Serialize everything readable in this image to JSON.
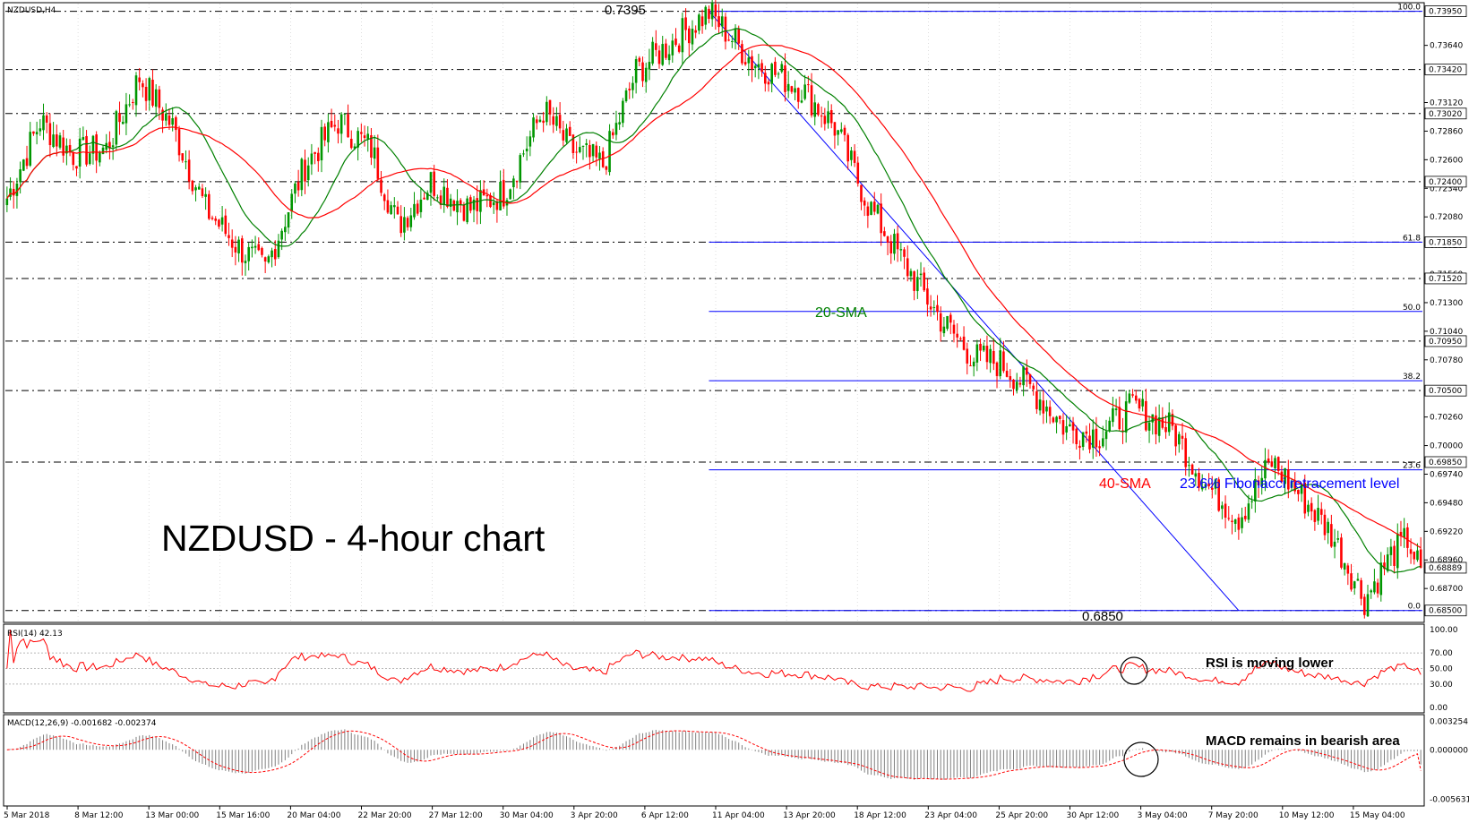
{
  "chart_data": {
    "type": "candlestick",
    "symbol_label": "NZDUSD,H4",
    "title": "NZDUSD - 4-hour chart",
    "colors": {
      "up": "#009600",
      "down": "#ff0000",
      "sma20": "#008000",
      "sma40": "#ff0000",
      "fib": "#0000ff",
      "trend": "#0000ff",
      "grid": "#000000",
      "rsi": "#ff0000",
      "macd_hist": "#808080",
      "macd_signal": "#ff0000"
    },
    "price_axis": {
      "ylim": [
        0.684,
        0.7402
      ],
      "ticks": [
        "0.73640",
        "0.73120",
        "0.72860",
        "0.72600",
        "0.72340",
        "0.72080",
        "0.71820",
        "0.71560",
        "0.71300",
        "0.71040",
        "0.70780",
        "0.70260",
        "0.70000",
        "0.69740",
        "0.69480",
        "0.69220",
        "0.68960",
        "0.68700"
      ],
      "boxed_levels": [
        "0.73950",
        "0.73420",
        "0.73020",
        "0.72400",
        "0.71850",
        "0.71520",
        "0.70950",
        "0.70500",
        "0.69850",
        "0.68889",
        "0.68500"
      ]
    },
    "x_tick_labels": [
      "5 Mar 2018",
      "8 Mar 12:00",
      "13 Mar 00:00",
      "15 Mar 16:00",
      "20 Mar 04:00",
      "22 Mar 20:00",
      "27 Mar 12:00",
      "30 Mar 04:00",
      "3 Apr 20:00",
      "6 Apr 12:00",
      "11 Apr 04:00",
      "13 Apr 20:00",
      "18 Apr 12:00",
      "23 Apr 04:00",
      "25 Apr 20:00",
      "30 Apr 12:00",
      "3 May 04:00",
      "7 May 20:00",
      "10 May 12:00",
      "15 May 04:00"
    ],
    "horizontal_levels": [
      0.7395,
      0.7342,
      0.7302,
      0.724,
      0.7185,
      0.7152,
      0.7095,
      0.705,
      0.6985,
      0.685
    ],
    "fibonacci": {
      "levels": [
        {
          "label": "100.0",
          "price": 0.7395
        },
        {
          "label": "61.8",
          "price": 0.7185
        },
        {
          "label": "50.0",
          "price": 0.7122
        },
        {
          "label": "38.2",
          "price": 0.7059
        },
        {
          "label": "23.6",
          "price": 0.6978
        },
        {
          "label": "0.0",
          "price": 0.685
        }
      ]
    },
    "extremes": {
      "high_label": "0.7395",
      "low_label": "0.6850"
    },
    "annotations": {
      "sma20": "20-SMA",
      "sma40": "40-SMA",
      "fib": "23.6% Fibonacci retracement level"
    },
    "anchor_prices": [
      [
        0,
        0.7225
      ],
      [
        10,
        0.7295
      ],
      [
        20,
        0.7265
      ],
      [
        30,
        0.727
      ],
      [
        40,
        0.7335
      ],
      [
        50,
        0.729
      ],
      [
        60,
        0.7215
      ],
      [
        70,
        0.718
      ],
      [
        78,
        0.716
      ],
      [
        90,
        0.7255
      ],
      [
        100,
        0.7295
      ],
      [
        110,
        0.727
      ],
      [
        118,
        0.72
      ],
      [
        128,
        0.724
      ],
      [
        140,
        0.7215
      ],
      [
        150,
        0.723
      ],
      [
        162,
        0.7305
      ],
      [
        170,
        0.727
      ],
      [
        180,
        0.7255
      ],
      [
        190,
        0.734
      ],
      [
        200,
        0.7365
      ],
      [
        208,
        0.7385
      ],
      [
        212,
        0.7394
      ],
      [
        225,
        0.735
      ],
      [
        240,
        0.7325
      ],
      [
        250,
        0.729
      ],
      [
        260,
        0.722
      ],
      [
        270,
        0.717
      ],
      [
        282,
        0.7115
      ],
      [
        292,
        0.708
      ],
      [
        300,
        0.7075
      ],
      [
        310,
        0.705
      ],
      [
        320,
        0.7015
      ],
      [
        330,
        0.701
      ],
      [
        340,
        0.7035
      ],
      [
        352,
        0.7015
      ],
      [
        362,
        0.6965
      ],
      [
        372,
        0.6935
      ],
      [
        382,
        0.6985
      ],
      [
        392,
        0.695
      ],
      [
        400,
        0.692
      ],
      [
        410,
        0.686
      ],
      [
        418,
        0.69
      ],
      [
        423,
        0.6915
      ],
      [
        427,
        0.6885
      ]
    ],
    "rsi": {
      "label": "RSI(14) 42.13",
      "value": 42.13,
      "ylim": [
        0,
        100
      ],
      "ticks": [
        "100.00",
        "70.00",
        "50.00",
        "30.00",
        "0.00"
      ],
      "annotation": "RSI is moving lower"
    },
    "macd": {
      "label": "MACD(12,26,9) -0.001682 -0.002374",
      "main": -0.001682,
      "signal": -0.002374,
      "ylim": [
        -0.006,
        0.0036
      ],
      "ticks": [
        "0.003254",
        "0.000000",
        "-0.005631"
      ],
      "annotation": "MACD remains in bearish area"
    }
  }
}
